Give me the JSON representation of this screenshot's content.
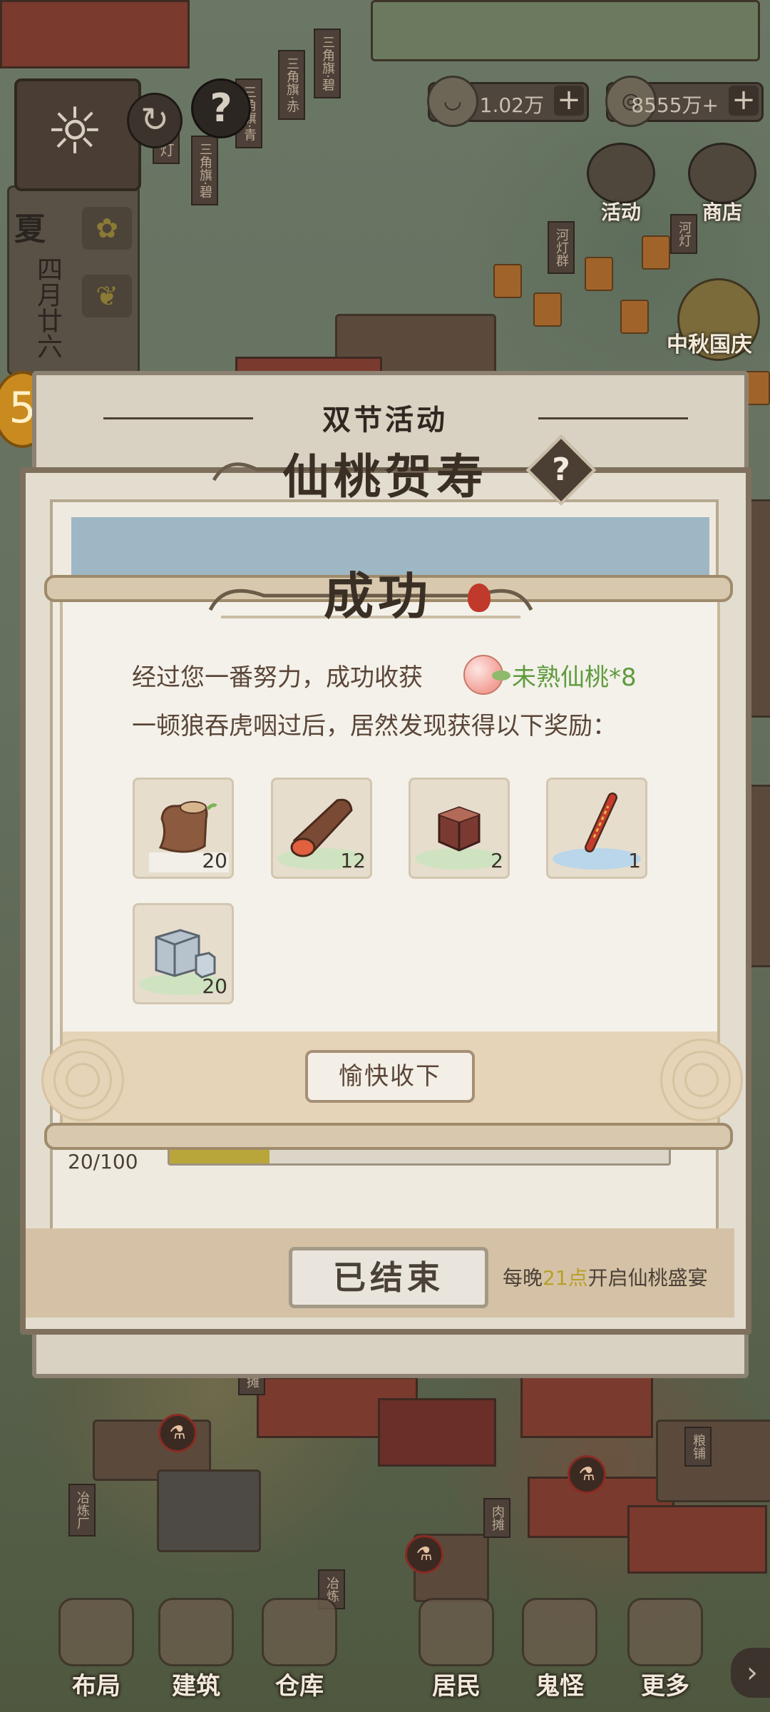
{
  "hud": {
    "resource_1": {
      "icon": "bowl-icon",
      "value": "1.02万"
    },
    "resource_2": {
      "icon": "coin-icon",
      "value": "8555万+"
    },
    "season": "夏",
    "date": "四月廿六",
    "top_buttons": [
      {
        "label": "活动",
        "icon": "calendar-icon"
      },
      {
        "label": "商店",
        "icon": "shop-icon"
      }
    ],
    "festival_label": "中秋国庆",
    "map_banners": [
      "花灯",
      "三角旗·碧",
      "三角旗·青",
      "三角旗·赤",
      "三角旗·碧",
      "河灯群",
      "河灯"
    ],
    "map_signs": [
      "肉摊",
      "冶炼厂",
      "冶炼",
      "肉摊",
      "粮铺"
    ]
  },
  "event": {
    "subtitle": "双节活动",
    "title": "仙桃贺寿",
    "progress_text": "20/100",
    "progress_fraction": 0.2,
    "ended_button": "已结束",
    "note_prefix": "每晚",
    "note_time": "21点",
    "note_suffix": "开启仙桃盛宴"
  },
  "dialog": {
    "title": "成功",
    "seal": "",
    "line1": "经过您一番努力，成功收获",
    "reward_main": "未熟仙桃*8",
    "line2": "一顿狼吞虎咽过后，居然发现获得以下奖励：",
    "items": [
      {
        "name": "wood-stump",
        "qty": "20"
      },
      {
        "name": "log",
        "qty": "12"
      },
      {
        "name": "red-block",
        "qty": "2"
      },
      {
        "name": "firework-stick",
        "qty": "1"
      },
      {
        "name": "stone-block",
        "qty": "20"
      }
    ],
    "accept_button": "愉快收下"
  },
  "bottom_nav": [
    {
      "label": "布局",
      "icon": "layout-icon"
    },
    {
      "label": "建筑",
      "icon": "building-icon"
    },
    {
      "label": "仓库",
      "icon": "warehouse-icon"
    },
    {
      "label": "居民",
      "icon": "resident-icon"
    },
    {
      "label": "鬼怪",
      "icon": "ghost-icon"
    },
    {
      "label": "更多",
      "icon": "more-icon"
    }
  ]
}
